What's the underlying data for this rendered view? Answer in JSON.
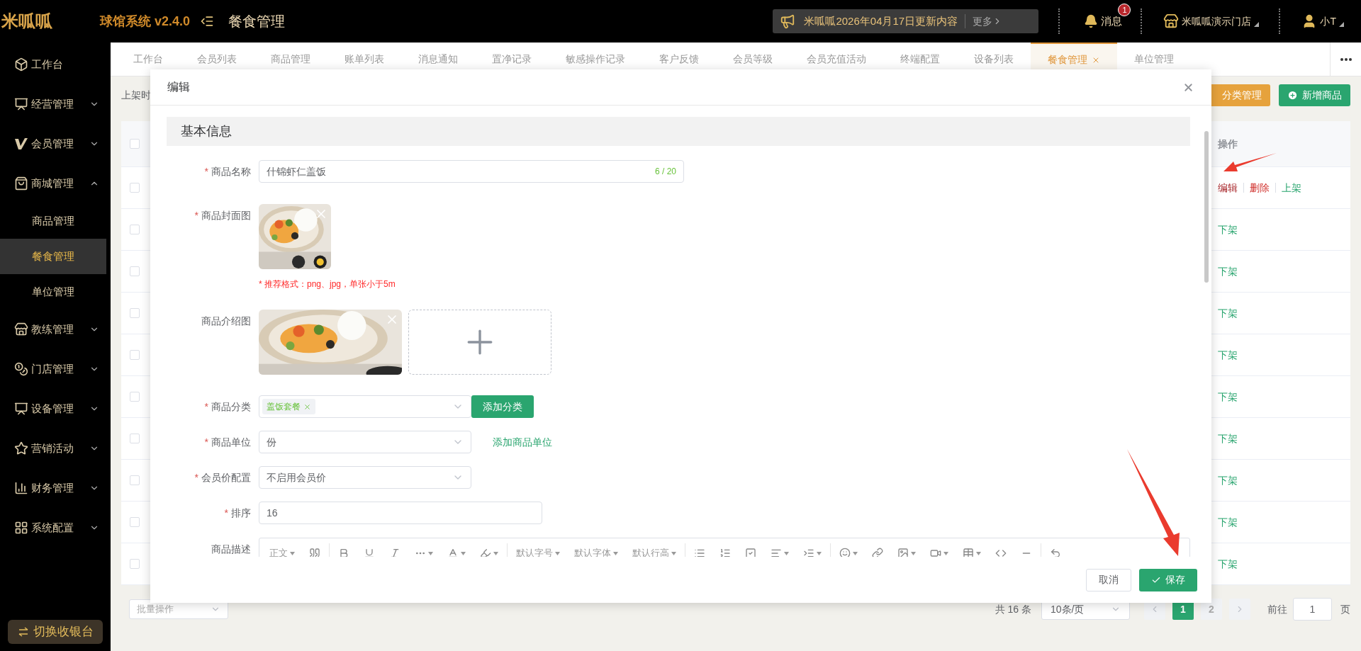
{
  "header": {
    "logo": "米呱呱",
    "system": "球馆系统 v2.4.0",
    "page_title": "餐食管理",
    "notice": "米呱呱2026年04月17日更新内容",
    "notice_more": "更多",
    "messages": {
      "label": "消息",
      "badge": "1"
    },
    "store": "米呱呱演示门店",
    "user": "小T"
  },
  "sidebar": {
    "items": [
      {
        "kind": "link",
        "label": "工作台"
      },
      {
        "kind": "group",
        "label": "经营管理",
        "expanded": false
      },
      {
        "kind": "group",
        "label": "会员管理",
        "expanded": false
      },
      {
        "kind": "group",
        "label": "商城管理",
        "expanded": true,
        "children": [
          {
            "label": "商品管理",
            "selected": false
          },
          {
            "label": "餐食管理",
            "selected": true
          },
          {
            "label": "单位管理",
            "selected": false
          }
        ]
      },
      {
        "kind": "group",
        "label": "教练管理",
        "expanded": false
      },
      {
        "kind": "group",
        "label": "门店管理",
        "expanded": false
      },
      {
        "kind": "group",
        "label": "设备管理",
        "expanded": false
      },
      {
        "kind": "group",
        "label": "营销活动",
        "expanded": false
      },
      {
        "kind": "group",
        "label": "财务管理",
        "expanded": false
      },
      {
        "kind": "group",
        "label": "系统配置",
        "expanded": false
      }
    ],
    "switch_button": "切换收银台"
  },
  "tabs": [
    {
      "label": "工作台",
      "selected": false
    },
    {
      "label": "会员列表",
      "selected": false
    },
    {
      "label": "商品管理",
      "selected": false
    },
    {
      "label": "账单列表",
      "selected": false
    },
    {
      "label": "消息通知",
      "selected": false
    },
    {
      "label": "置净记录",
      "selected": false
    },
    {
      "label": "敏感操作记录",
      "selected": false
    },
    {
      "label": "客户反馈",
      "selected": false
    },
    {
      "label": "会员等级",
      "selected": false
    },
    {
      "label": "会员充值活动",
      "selected": false
    },
    {
      "label": "终端配置",
      "selected": false
    },
    {
      "label": "设备列表",
      "selected": false
    },
    {
      "label": "餐食管理",
      "selected": true
    },
    {
      "label": "单位管理",
      "selected": false
    }
  ],
  "toolbar": {
    "filter_label": "上架时",
    "buttons": [
      {
        "kind": "warning",
        "label": "分类管理"
      },
      {
        "kind": "primary",
        "label": "新增商品"
      }
    ]
  },
  "table": {
    "header_checked": false,
    "action_column": "操作",
    "rows": [
      {
        "checked": false,
        "actions": [
          {
            "kind": "edit",
            "label": "编辑"
          },
          {
            "kind": "delete",
            "label": "删除"
          },
          {
            "kind": "publish",
            "label": "上架"
          }
        ]
      },
      {
        "checked": false,
        "actions": [
          {
            "kind": "publish",
            "label": "下架"
          }
        ]
      },
      {
        "checked": false,
        "actions": [
          {
            "kind": "publish",
            "label": "下架"
          }
        ]
      },
      {
        "checked": false,
        "actions": [
          {
            "kind": "publish",
            "label": "下架"
          }
        ]
      },
      {
        "checked": false,
        "actions": [
          {
            "kind": "publish",
            "label": "下架"
          }
        ]
      },
      {
        "checked": false,
        "actions": [
          {
            "kind": "publish",
            "label": "下架"
          }
        ]
      },
      {
        "checked": false,
        "actions": [
          {
            "kind": "publish",
            "label": "下架"
          }
        ]
      },
      {
        "checked": false,
        "actions": [
          {
            "kind": "publish",
            "label": "下架"
          }
        ]
      },
      {
        "checked": false,
        "actions": [
          {
            "kind": "publish",
            "label": "下架"
          }
        ]
      },
      {
        "checked": false,
        "actions": [
          {
            "kind": "publish",
            "label": "下架"
          }
        ]
      }
    ]
  },
  "pagination": {
    "batch": "批量操作",
    "total": "共 16 条",
    "page_size": "10条/页",
    "pages": [
      {
        "label": "1",
        "selected": true
      },
      {
        "label": "2",
        "selected": false
      }
    ],
    "goto_label": "前往",
    "goto_value": "1",
    "page_suffix": "页"
  },
  "dialog": {
    "title": "编辑",
    "section": "基本信息",
    "fields": [
      {
        "kind": "text",
        "label": "商品名称",
        "mark": "*",
        "value": "什锦虾仁盖饭",
        "counter": "6 / 20"
      },
      {
        "kind": "cover",
        "label": "商品封面图",
        "mark": "*",
        "hint": "* 推荐格式：png、jpg，单张小于5m"
      },
      {
        "kind": "gallery",
        "label": "商品介绍图"
      },
      {
        "kind": "tags",
        "label": "商品分类",
        "mark": "*",
        "tags": [
          "盖饭套餐"
        ],
        "button": "添加分类"
      },
      {
        "kind": "select",
        "label": "商品单位",
        "mark": "*",
        "value": "份",
        "link": "添加商品单位"
      },
      {
        "kind": "select",
        "label": "会员价配置",
        "mark": "*",
        "value": "不启用会员价"
      },
      {
        "kind": "short",
        "label": "排序",
        "mark": "*",
        "value": "16"
      },
      {
        "kind": "editor",
        "label": "商品描述",
        "toolbar_labels": [
          "正文",
          "默认字号",
          "默认字体",
          "默认行高"
        ]
      }
    ],
    "cancel": "取消",
    "save": "保存"
  }
}
